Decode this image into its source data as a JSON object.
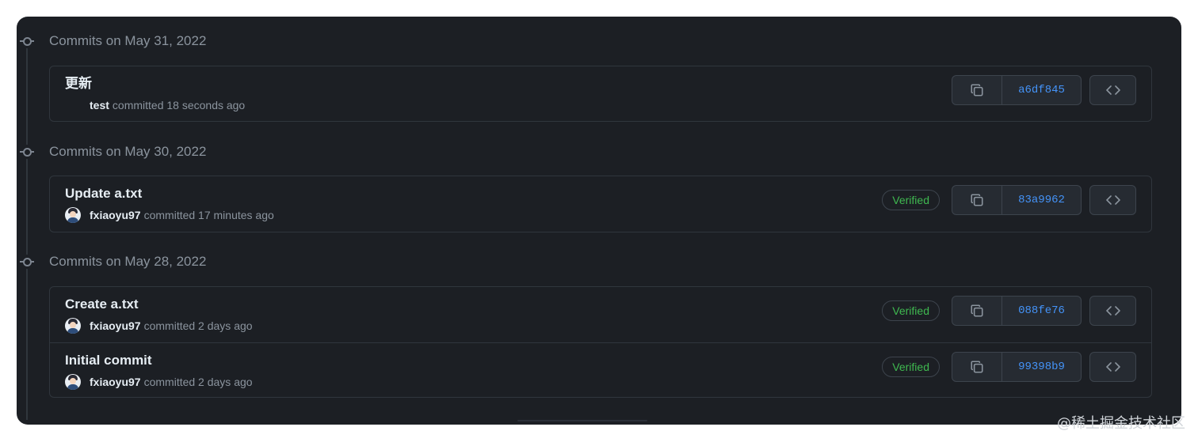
{
  "groups": [
    {
      "title": "Commits on May 31, 2022",
      "commits": [
        {
          "message": "更新",
          "author": "test",
          "action": "committed 18 seconds ago",
          "sha": "a6df845",
          "verified": ""
        }
      ]
    },
    {
      "title": "Commits on May 30, 2022",
      "commits": [
        {
          "message": "Update a.txt",
          "author": "fxiaoyu97",
          "action": "committed 17 minutes ago",
          "sha": "83a9962",
          "verified": "Verified"
        }
      ]
    },
    {
      "title": "Commits on May 28, 2022",
      "commits": [
        {
          "message": "Create a.txt",
          "author": "fxiaoyu97",
          "action": "committed 2 days ago",
          "sha": "088fe76",
          "verified": "Verified"
        },
        {
          "message": "Initial commit",
          "author": "fxiaoyu97",
          "action": "committed 2 days ago",
          "sha": "99398b9",
          "verified": "Verified"
        }
      ]
    }
  ],
  "icons": {
    "timeline": "git-commit-icon",
    "copy": "copy-icon",
    "browse": "code-icon",
    "avatar": "user-avatar"
  },
  "colors": {
    "background": "#1c1f24",
    "sha_link": "#4493f8",
    "verified": "#3fb950",
    "border": "#30363d"
  },
  "watermark": "@稀土掘金技术社区"
}
